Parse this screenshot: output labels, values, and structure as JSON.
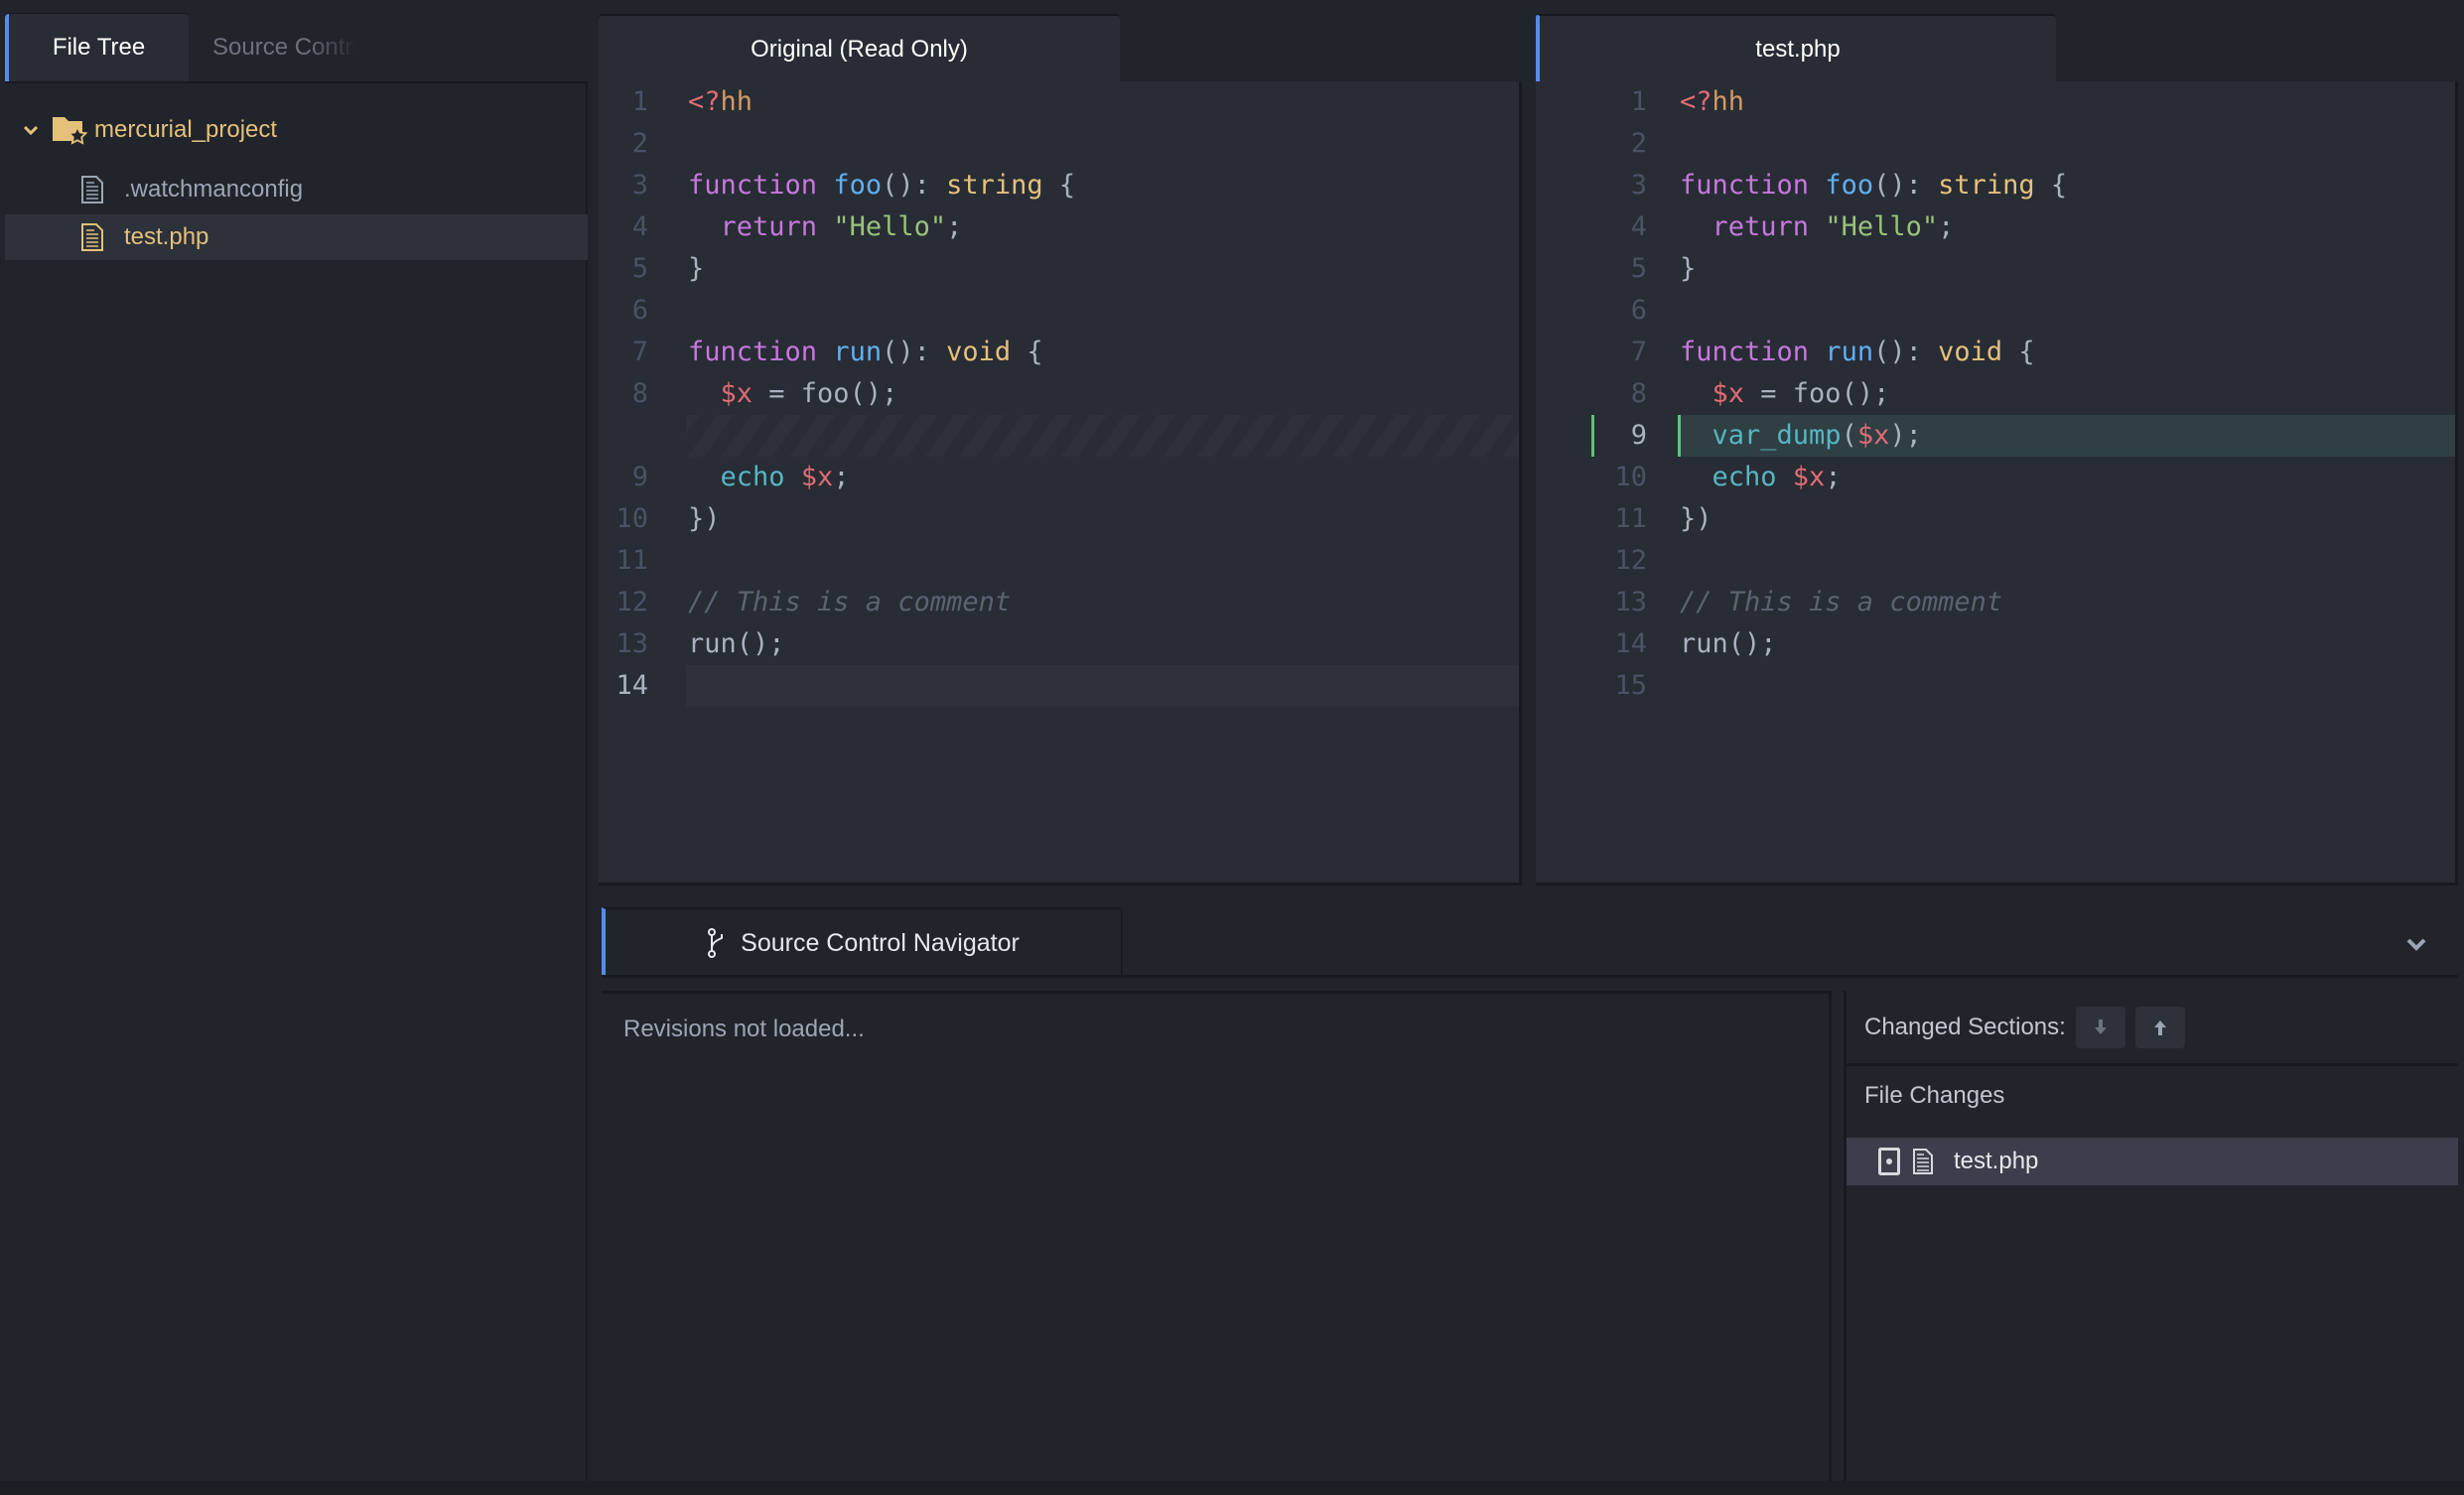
{
  "sidebar": {
    "tabs": [
      {
        "label": "File Tree",
        "active": true
      },
      {
        "label": "Source Control",
        "active": false
      }
    ],
    "tree": {
      "root": {
        "label": "mercurial_project",
        "expanded": true,
        "icon": "folder-star-icon"
      },
      "files": [
        {
          "label": ".watchmanconfig",
          "selected": false,
          "modified": false
        },
        {
          "label": "test.php",
          "selected": true,
          "modified": true
        }
      ]
    }
  },
  "editors": {
    "left": {
      "tab_label": "Original (Read Only)",
      "lines": [
        {
          "n": "1",
          "tokens": [
            [
              "tag",
              "<?"
            ],
            [
              "tagn",
              "hh"
            ]
          ]
        },
        {
          "n": "2",
          "tokens": []
        },
        {
          "n": "3",
          "tokens": [
            [
              "kw",
              "function "
            ],
            [
              "fn",
              "foo"
            ],
            [
              "pl",
              "(): "
            ],
            [
              "ty",
              "string"
            ],
            [
              "pl",
              " {"
            ]
          ]
        },
        {
          "n": "4",
          "tokens": [
            [
              "pl",
              "  "
            ],
            [
              "kw",
              "return "
            ],
            [
              "str",
              "\"Hello\""
            ],
            [
              "pl",
              ";"
            ]
          ]
        },
        {
          "n": "5",
          "tokens": [
            [
              "pl",
              "}"
            ]
          ]
        },
        {
          "n": "6",
          "tokens": []
        },
        {
          "n": "7",
          "tokens": [
            [
              "kw",
              "function "
            ],
            [
              "fn",
              "run"
            ],
            [
              "pl",
              "(): "
            ],
            [
              "ty",
              "void"
            ],
            [
              "pl",
              " {"
            ]
          ]
        },
        {
          "n": "8",
          "tokens": [
            [
              "pl",
              "  "
            ],
            [
              "var",
              "$x"
            ],
            [
              "pl",
              " = foo();"
            ]
          ]
        },
        {
          "n": "",
          "tokens": [],
          "placeholder": true
        },
        {
          "n": "9",
          "tokens": [
            [
              "pl",
              "  "
            ],
            [
              "bi",
              "echo "
            ],
            [
              "var",
              "$x"
            ],
            [
              "pl",
              ";"
            ]
          ]
        },
        {
          "n": "10",
          "tokens": [
            [
              "pl",
              "})"
            ]
          ]
        },
        {
          "n": "11",
          "tokens": []
        },
        {
          "n": "12",
          "tokens": [
            [
              "cm",
              "// This is a comment"
            ]
          ]
        },
        {
          "n": "13",
          "tokens": [
            [
              "pl",
              "run();"
            ]
          ]
        },
        {
          "n": "14",
          "tokens": [],
          "current": true
        }
      ]
    },
    "right": {
      "tab_label": "test.php",
      "lines": [
        {
          "n": "1",
          "tokens": [
            [
              "tag",
              "<?"
            ],
            [
              "tagn",
              "hh"
            ]
          ]
        },
        {
          "n": "2",
          "tokens": []
        },
        {
          "n": "3",
          "tokens": [
            [
              "kw",
              "function "
            ],
            [
              "fn",
              "foo"
            ],
            [
              "pl",
              "(): "
            ],
            [
              "ty",
              "string"
            ],
            [
              "pl",
              " {"
            ]
          ]
        },
        {
          "n": "4",
          "tokens": [
            [
              "pl",
              "  "
            ],
            [
              "kw",
              "return "
            ],
            [
              "str",
              "\"Hello\""
            ],
            [
              "pl",
              ";"
            ]
          ]
        },
        {
          "n": "5",
          "tokens": [
            [
              "pl",
              "}"
            ]
          ]
        },
        {
          "n": "6",
          "tokens": []
        },
        {
          "n": "7",
          "tokens": [
            [
              "kw",
              "function "
            ],
            [
              "fn",
              "run"
            ],
            [
              "pl",
              "(): "
            ],
            [
              "ty",
              "void"
            ],
            [
              "pl",
              " {"
            ]
          ]
        },
        {
          "n": "8",
          "tokens": [
            [
              "pl",
              "  "
            ],
            [
              "var",
              "$x"
            ],
            [
              "pl",
              " = foo();"
            ]
          ]
        },
        {
          "n": "9",
          "tokens": [
            [
              "pl",
              "  "
            ],
            [
              "bi",
              "var_dump"
            ],
            [
              "pl",
              "("
            ],
            [
              "var",
              "$x"
            ],
            [
              "pl",
              ");"
            ]
          ],
          "added": true
        },
        {
          "n": "10",
          "tokens": [
            [
              "pl",
              "  "
            ],
            [
              "bi",
              "echo "
            ],
            [
              "var",
              "$x"
            ],
            [
              "pl",
              ";"
            ]
          ]
        },
        {
          "n": "11",
          "tokens": [
            [
              "pl",
              "})"
            ]
          ]
        },
        {
          "n": "12",
          "tokens": []
        },
        {
          "n": "13",
          "tokens": [
            [
              "cm",
              "// This is a comment"
            ]
          ]
        },
        {
          "n": "14",
          "tokens": [
            [
              "pl",
              "run();"
            ]
          ]
        },
        {
          "n": "15",
          "tokens": []
        }
      ]
    }
  },
  "bottom_panel": {
    "tab_label": "Source Control Navigator",
    "tab_icon": "git-branch-icon",
    "collapse_icon": "chevron-down-icon",
    "revisions_status": "Revisions not loaded...",
    "changed_sections_label": "Changed Sections:",
    "next_section_icon": "arrow-down-icon",
    "prev_section_icon": "arrow-up-icon",
    "file_changes_label": "File Changes",
    "file_changes": [
      {
        "label": "test.php",
        "status": "modified"
      }
    ]
  },
  "colors": {
    "accent": "#568af2",
    "added_gutter": "#5ec479",
    "modified_file": "#e5c07b"
  }
}
